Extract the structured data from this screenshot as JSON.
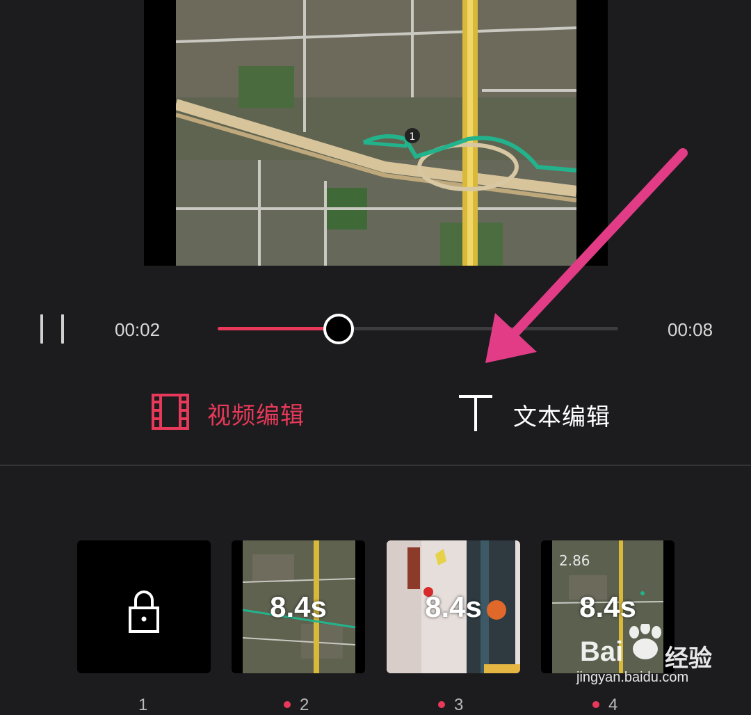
{
  "player": {
    "pause_icon": "pause-icon",
    "time_current": "00:02",
    "time_total": "00:08",
    "progress": 0.27
  },
  "tabs": [
    {
      "label": "视频编辑",
      "icon": "film-icon",
      "active": true
    },
    {
      "label": "文本编辑",
      "icon": "text-t-icon",
      "active": false
    }
  ],
  "clips": [
    {
      "label": "",
      "index": "1",
      "locked": true,
      "icon": "lock-icon"
    },
    {
      "label": "8.4s",
      "index": "2"
    },
    {
      "label": "8.4s",
      "index": "3"
    },
    {
      "label": "8.4s",
      "index": "4",
      "overlay_text": "2.86"
    }
  ],
  "map_marker": "1",
  "watermark": {
    "brand": "Bai",
    "brand_suffix": "经验",
    "url": "jingyan.baidu.com"
  },
  "colors": {
    "accent": "#e8395a",
    "background": "#1c1c1e",
    "arrow": "#e23c86",
    "route": "#21a883"
  }
}
